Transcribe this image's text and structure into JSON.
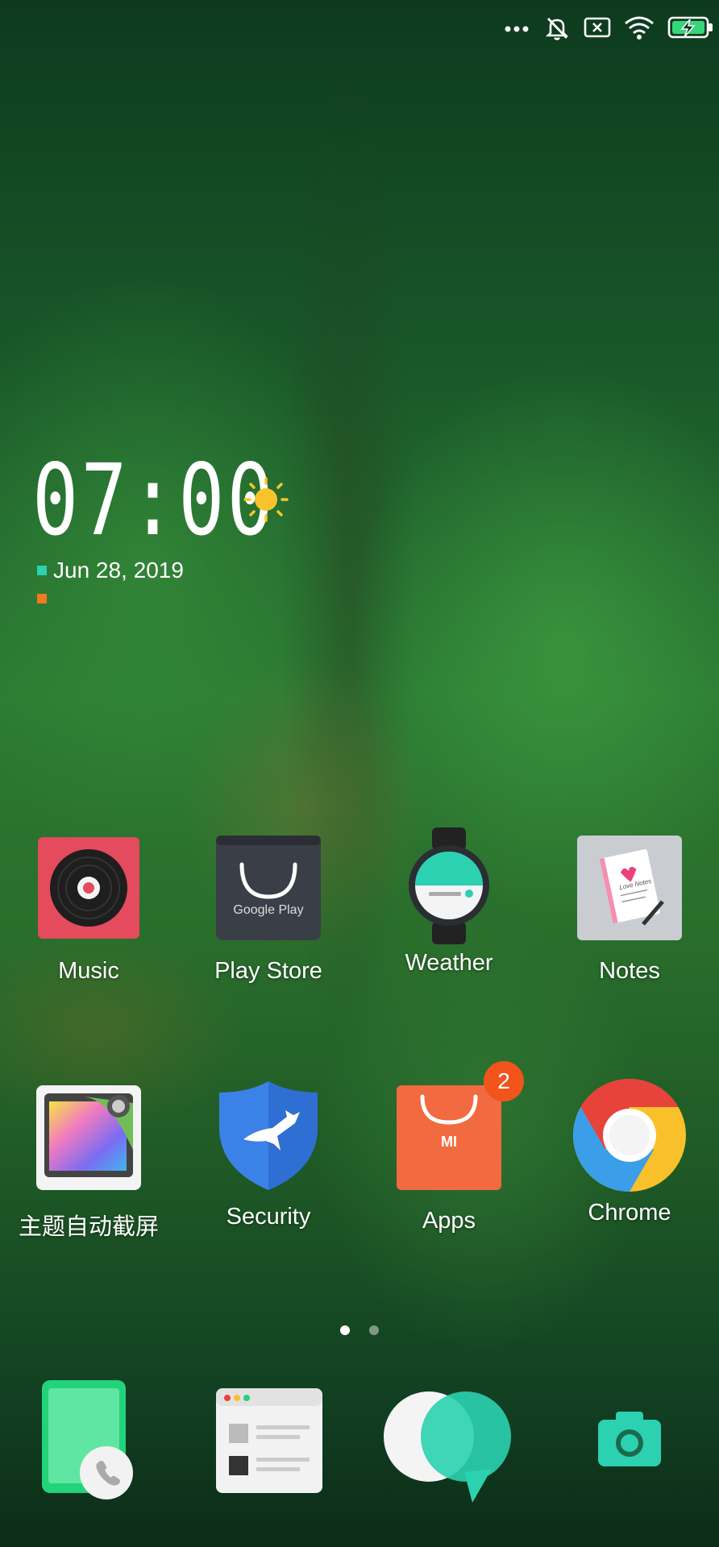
{
  "status_bar": {
    "icons": [
      "more-dots-icon",
      "mute-bell-icon",
      "sim-x-icon",
      "wifi-icon",
      "battery-charging-icon"
    ],
    "colors": {
      "battery_fill": "#37d67a"
    }
  },
  "clock_widget": {
    "time": "07:00",
    "date": "Jun 28, 2019",
    "weather_icon": "sun-icon",
    "colors": {
      "sun": "#f7c52b",
      "marker_1": "#2bd1b0",
      "marker_2": "#f07a1e"
    }
  },
  "apps_row1": [
    {
      "label": "Music",
      "icon": "music-disc-icon"
    },
    {
      "label": "Play Store",
      "icon": "google-play-bag-icon",
      "icon_text": "Google Play"
    },
    {
      "label": "Weather",
      "icon": "smartwatch-icon"
    },
    {
      "label": "Notes",
      "icon": "notebook-icon",
      "icon_text": "Love Notes"
    }
  ],
  "apps_row2": [
    {
      "label": "主题自动截屏",
      "icon": "theme-gallery-icon"
    },
    {
      "label": "Security",
      "icon": "shield-deer-icon"
    },
    {
      "label": "Apps",
      "icon": "mi-bag-icon",
      "icon_text": "MI",
      "badge": "2"
    },
    {
      "label": "Chrome",
      "icon": "chrome-icon"
    }
  ],
  "page_indicator": {
    "pages": 2,
    "current": 1
  },
  "dock": [
    {
      "name": "phone",
      "icon": "phone-icon"
    },
    {
      "name": "browser",
      "icon": "browser-window-icon"
    },
    {
      "name": "messages",
      "icon": "chat-bubbles-icon"
    },
    {
      "name": "camera",
      "icon": "camera-icon"
    }
  ]
}
